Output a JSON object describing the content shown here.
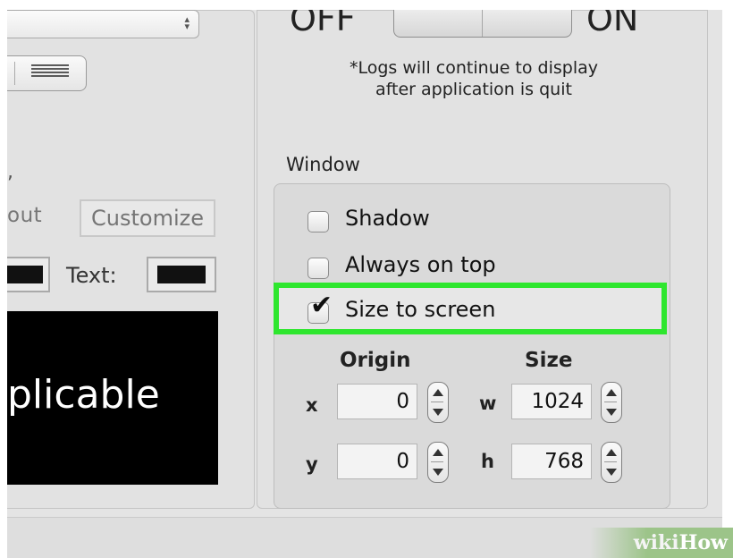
{
  "left": {
    "popup_arrows": "⌃⌄",
    "comma": ",",
    "about_text": "out",
    "customize_label": "Customize",
    "text_label": "Text:",
    "preview_text": "plicable"
  },
  "log_toggle": {
    "off_label": "OFF",
    "on_label": "ON",
    "note_line1": "*Logs will continue to display",
    "note_line2": "after application is quit"
  },
  "window": {
    "title": "Window",
    "options": [
      {
        "label": "Shadow",
        "checked": false
      },
      {
        "label": "Always on top",
        "checked": false
      },
      {
        "label": "Size to screen",
        "checked": true
      }
    ],
    "origin_header": "Origin",
    "size_header": "Size",
    "x_label": "x",
    "y_label": "y",
    "w_label": "w",
    "h_label": "h",
    "x_value": "0",
    "y_value": "0",
    "w_value": "1024",
    "h_value": "768"
  },
  "watermark": {
    "part1": "wiki",
    "part2": "How"
  },
  "colors": {
    "highlight": "#2ee62e",
    "preview_bg": "#000000"
  }
}
